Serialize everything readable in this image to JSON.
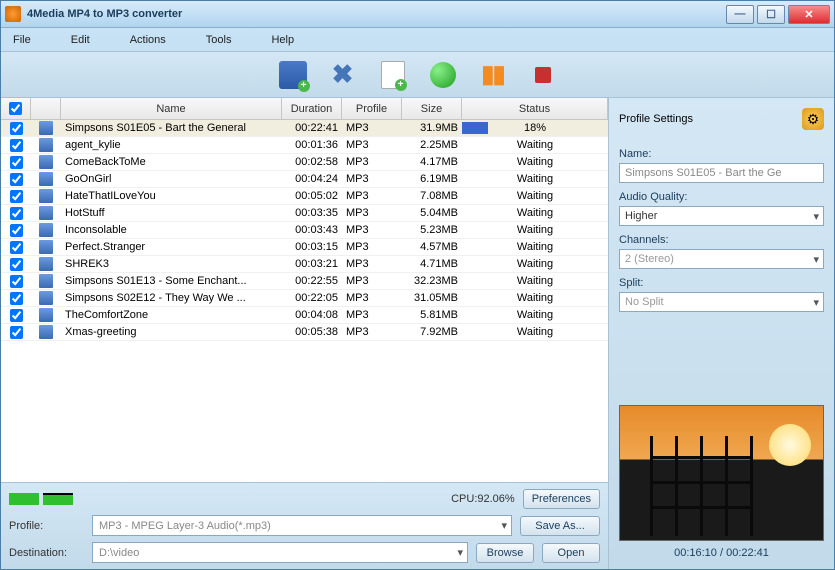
{
  "window": {
    "title": "4Media MP4 to MP3 converter"
  },
  "menu": [
    "File",
    "Edit",
    "Actions",
    "Tools",
    "Help"
  ],
  "columns": {
    "name": "Name",
    "duration": "Duration",
    "profile": "Profile",
    "size": "Size",
    "status": "Status"
  },
  "rows": [
    {
      "checked": true,
      "name": "Simpsons S01E05 - Bart the General",
      "duration": "00:22:41",
      "profile": "MP3",
      "size": "31.9MB",
      "status": "18%",
      "progress": 18,
      "selected": true
    },
    {
      "checked": true,
      "name": "agent_kylie",
      "duration": "00:01:36",
      "profile": "MP3",
      "size": "2.25MB",
      "status": "Waiting"
    },
    {
      "checked": true,
      "name": "ComeBackToMe",
      "duration": "00:02:58",
      "profile": "MP3",
      "size": "4.17MB",
      "status": "Waiting"
    },
    {
      "checked": true,
      "name": "GoOnGirl",
      "duration": "00:04:24",
      "profile": "MP3",
      "size": "6.19MB",
      "status": "Waiting"
    },
    {
      "checked": true,
      "name": "HateThatILoveYou",
      "duration": "00:05:02",
      "profile": "MP3",
      "size": "7.08MB",
      "status": "Waiting"
    },
    {
      "checked": true,
      "name": "HotStuff",
      "duration": "00:03:35",
      "profile": "MP3",
      "size": "5.04MB",
      "status": "Waiting"
    },
    {
      "checked": true,
      "name": "Inconsolable",
      "duration": "00:03:43",
      "profile": "MP3",
      "size": "5.23MB",
      "status": "Waiting"
    },
    {
      "checked": true,
      "name": "Perfect.Stranger",
      "duration": "00:03:15",
      "profile": "MP3",
      "size": "4.57MB",
      "status": "Waiting"
    },
    {
      "checked": true,
      "name": "SHREK3",
      "duration": "00:03:21",
      "profile": "MP3",
      "size": "4.71MB",
      "status": "Waiting"
    },
    {
      "checked": true,
      "name": "Simpsons S01E13 - Some Enchant...",
      "duration": "00:22:55",
      "profile": "MP3",
      "size": "32.23MB",
      "status": "Waiting"
    },
    {
      "checked": true,
      "name": "Simpsons S02E12 - They Way We ...",
      "duration": "00:22:05",
      "profile": "MP3",
      "size": "31.05MB",
      "status": "Waiting"
    },
    {
      "checked": true,
      "name": "TheComfortZone",
      "duration": "00:04:08",
      "profile": "MP3",
      "size": "5.81MB",
      "status": "Waiting"
    },
    {
      "checked": true,
      "name": "Xmas-greeting",
      "duration": "00:05:38",
      "profile": "MP3",
      "size": "7.92MB",
      "status": "Waiting"
    }
  ],
  "cpu": {
    "label": "CPU:92.06%",
    "cores": [
      98,
      86
    ]
  },
  "buttons": {
    "preferences": "Preferences",
    "saveAs": "Save As...",
    "browse": "Browse",
    "open": "Open"
  },
  "profileRow": {
    "label": "Profile:",
    "value": "MP3 - MPEG Layer-3 Audio(*.mp3)"
  },
  "destRow": {
    "label": "Destination:",
    "value": "D:\\video"
  },
  "settings": {
    "title": "Profile Settings",
    "nameLabel": "Name:",
    "nameValue": "Simpsons S01E05 - Bart the Ge",
    "qualityLabel": "Audio Quality:",
    "qualityValue": "Higher",
    "channelsLabel": "Channels:",
    "channelsValue": "2 (Stereo)",
    "splitLabel": "Split:",
    "splitValue": "No Split"
  },
  "preview": {
    "time": "00:16:10 / 00:22:41"
  }
}
